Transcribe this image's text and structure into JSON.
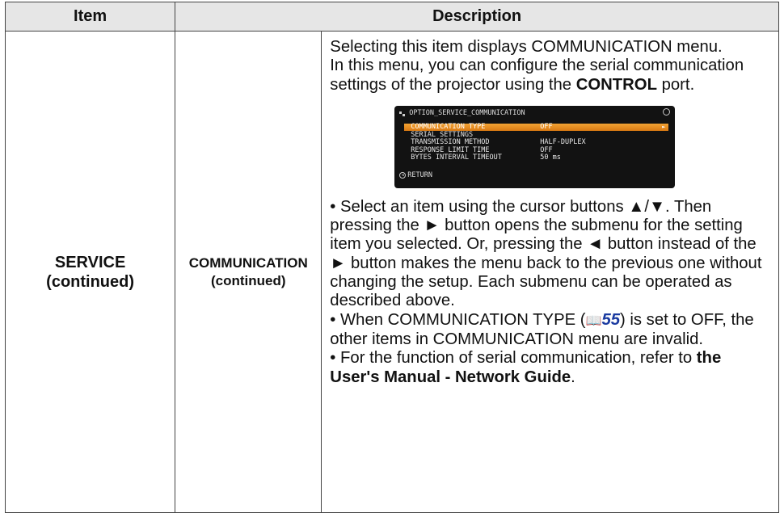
{
  "header": {
    "item": "Item",
    "description": "Description"
  },
  "row": {
    "item_line1": "SERVICE",
    "item_line2": "(continued)",
    "sub_line1": "COMMUNICATION",
    "sub_line2": "(continued)"
  },
  "desc": {
    "p1": "Selecting this item displays COMMUNICATION menu.",
    "p2_a": "In this menu, you can configure the serial communication settings of the projector using the ",
    "p2_b": "CONTROL",
    "p2_c": " port.",
    "p3": "• Select an item using the cursor buttons ▲/▼. Then pressing the ► button opens the submenu for the setting item you selected. Or, pressing the ◄ button instead of the ► button makes the menu back to the previous one without changing the setup. Each submenu can be operated as described above.",
    "p4_a": "• When COMMUNICATION TYPE (",
    "p4_ref_icon": "📖",
    "p4_ref": "55",
    "p4_b": ") is set to OFF, the other items in COMMUNICATION menu are invalid.",
    "p5_a": "• For the function of serial communication, refer to ",
    "p5_b": "the User's Manual - Network Guide",
    "p5_c": "."
  },
  "osd": {
    "title": "OPTION_SERVICE_COMMUNICATION",
    "rows": [
      {
        "label": "COMMUNICATION TYPE",
        "value": "OFF"
      },
      {
        "label": "SERIAL SETTINGS",
        "value": ""
      },
      {
        "label": "TRANSMISSION METHOD",
        "value": "HALF-DUPLEX"
      },
      {
        "label": "RESPONSE LIMIT TIME",
        "value": "OFF"
      },
      {
        "label": "BYTES INTERVAL TIMEOUT",
        "value": "50 ms"
      }
    ],
    "footer": "RETURN",
    "colors": {
      "highlight": "#e8901f",
      "background": "#121212"
    }
  }
}
